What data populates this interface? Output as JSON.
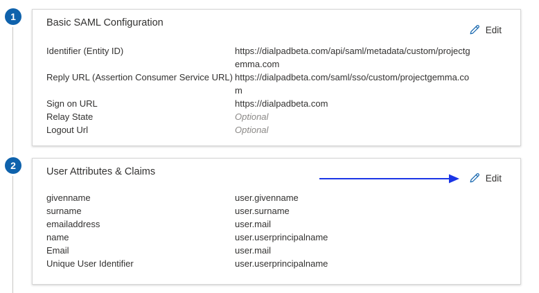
{
  "steps": [
    "1",
    "2"
  ],
  "saml": {
    "title": "Basic SAML Configuration",
    "edit_label": "Edit",
    "rows": [
      {
        "key": "Identifier (Entity ID)",
        "value": "https://dialpadbeta.com/api/saml/metadata/custom/projectgemma.com"
      },
      {
        "key": "Reply URL (Assertion Consumer Service URL)",
        "value": "https://dialpadbeta.com/saml/sso/custom/projectgemma.com"
      },
      {
        "key": "Sign on URL",
        "value": "https://dialpadbeta.com"
      },
      {
        "key": "Relay State",
        "value": "Optional"
      },
      {
        "key": "Logout Url",
        "value": "Optional"
      }
    ]
  },
  "claims": {
    "title": "User Attributes & Claims",
    "edit_label": "Edit",
    "rows": [
      {
        "key": "givenname",
        "value": "user.givenname"
      },
      {
        "key": "surname",
        "value": "user.surname"
      },
      {
        "key": "emailaddress",
        "value": "user.mail"
      },
      {
        "key": "name",
        "value": "user.userprincipalname"
      },
      {
        "key": "Email",
        "value": "user.mail"
      },
      {
        "key": "Unique User Identifier",
        "value": "user.userprincipalname"
      }
    ]
  },
  "colors": {
    "step_badge": "#0f62ac",
    "arrow": "#1a35e6",
    "edit_icon": "#0f62ac",
    "optional_text": "#8a8886"
  },
  "icons": {
    "edit": "pencil-icon",
    "annotation": "arrow-right-icon"
  }
}
